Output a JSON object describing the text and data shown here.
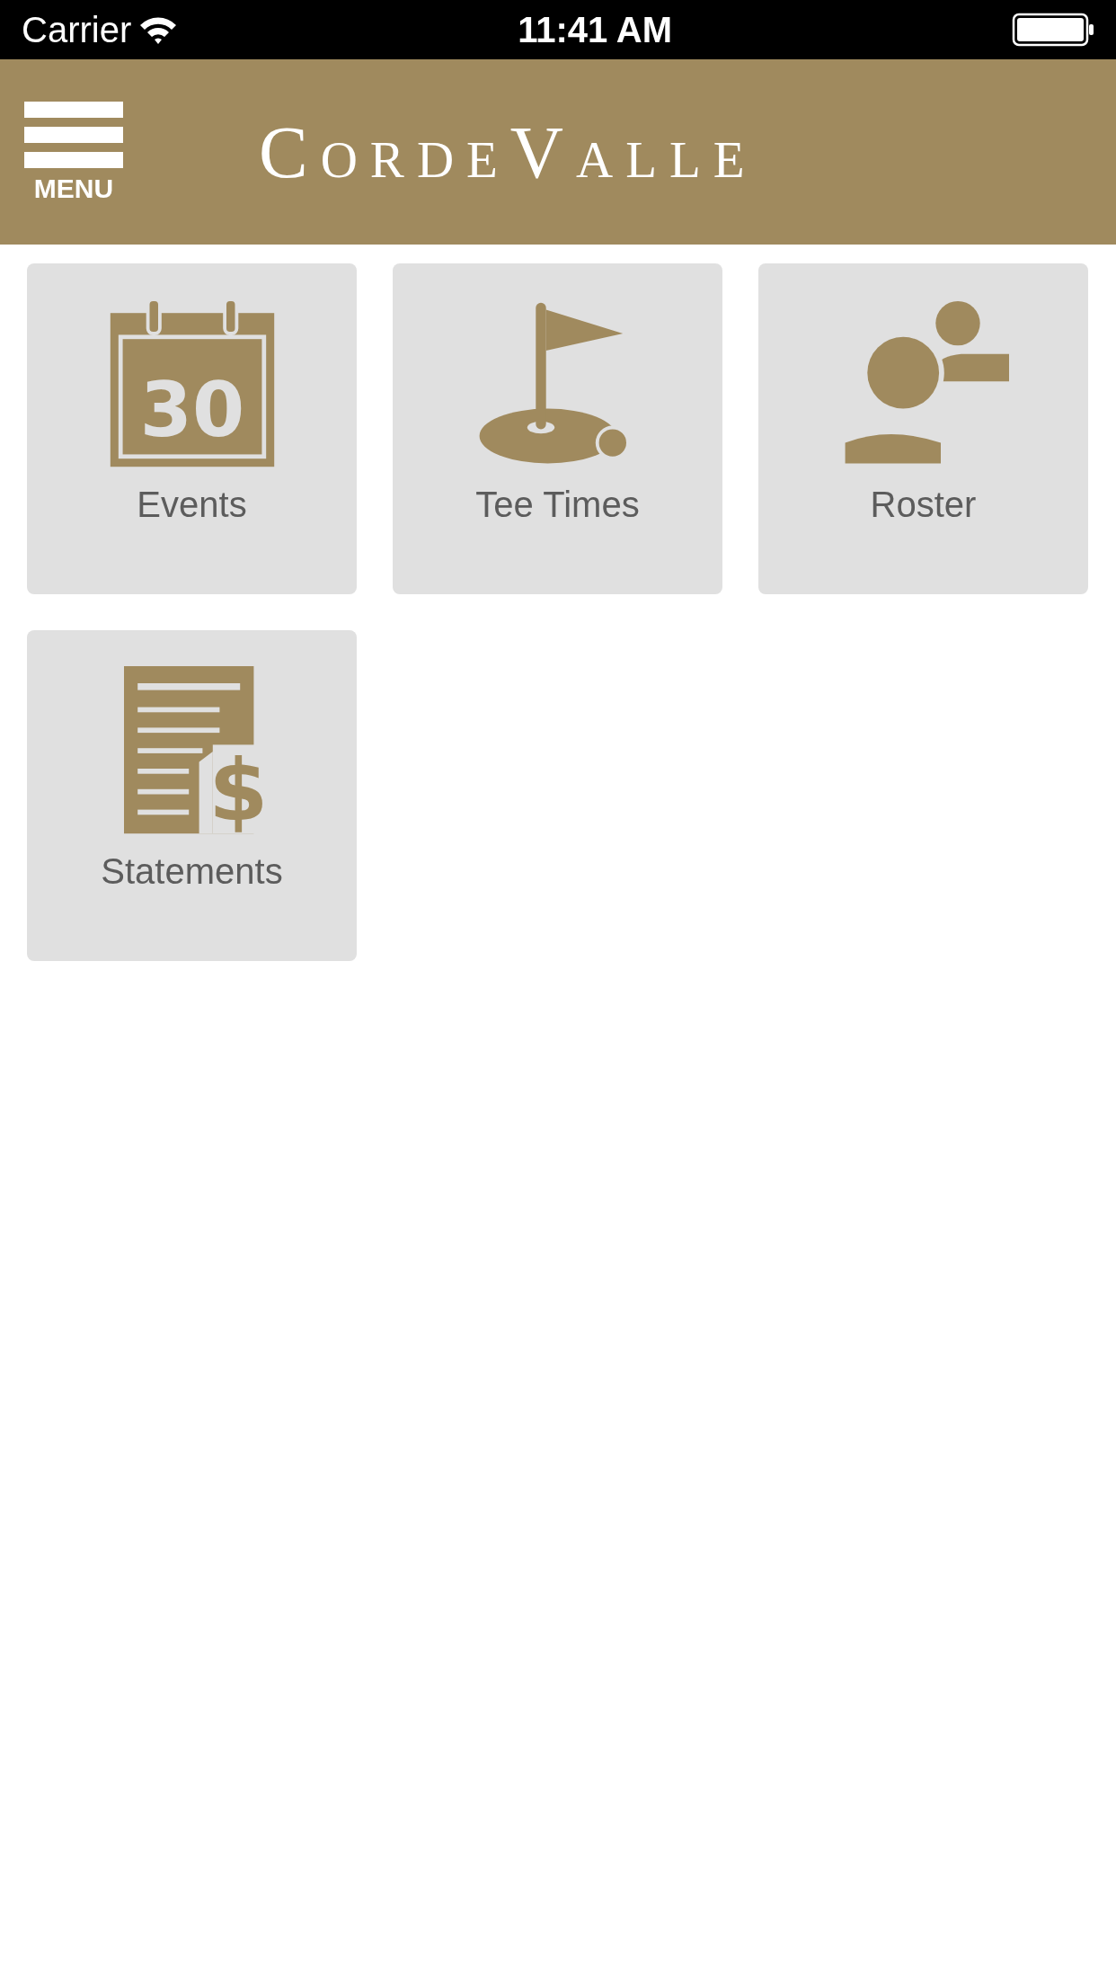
{
  "status_bar": {
    "carrier": "Carrier",
    "time": "11:41 AM"
  },
  "header": {
    "menu_label": "MENU",
    "logo": "CordeValle"
  },
  "tiles": [
    {
      "label": "Events",
      "kind": "calendar",
      "symbol": "30"
    },
    {
      "label": "Tee Times",
      "kind": "flag"
    },
    {
      "label": "Roster",
      "kind": "people"
    },
    {
      "label": "Statements",
      "kind": "statement",
      "symbol": "$"
    }
  ]
}
